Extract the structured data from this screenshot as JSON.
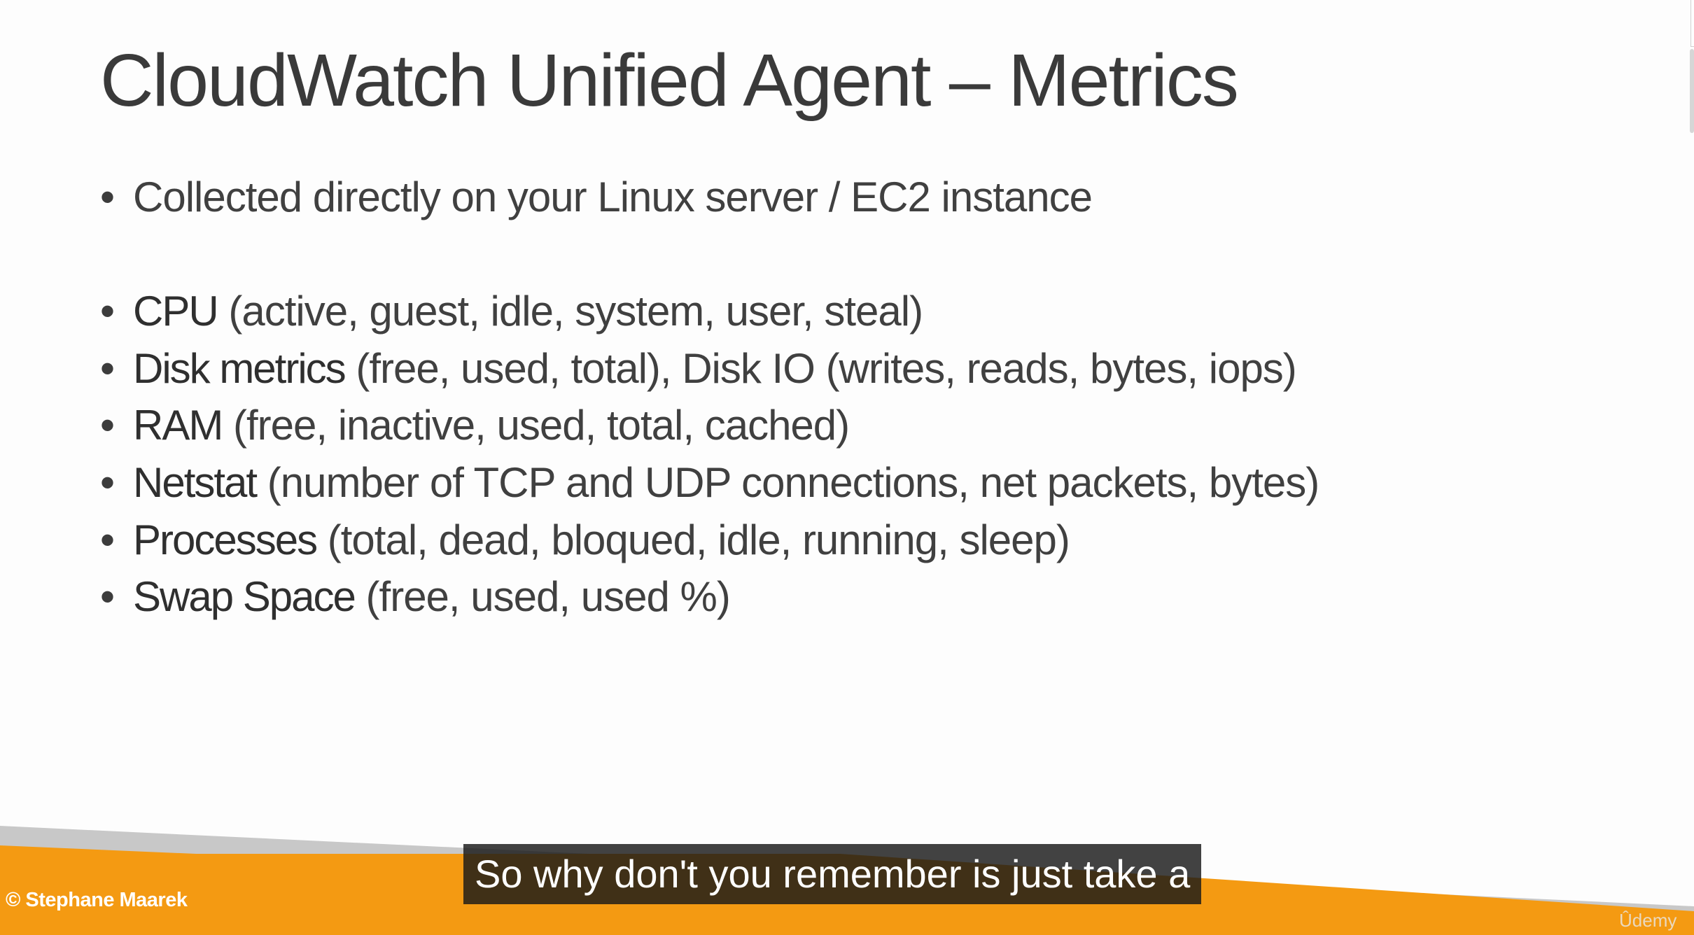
{
  "slide": {
    "title": "CloudWatch Unified Agent – Metrics",
    "bullets": [
      {
        "term": "",
        "desc": "Collected directly on your Linux server / EC2 instance"
      },
      {
        "term": "CPU",
        "desc": " (active, guest, idle, system, user, steal)"
      },
      {
        "term": "Disk metrics",
        "desc": " (free, used, total), Disk IO  (writes, reads, bytes, iops)"
      },
      {
        "term": "RAM",
        "desc": " (free, inactive, used, total, cached)"
      },
      {
        "term": "Netstat",
        "desc": " (number of TCP and UDP connections, net packets, bytes)"
      },
      {
        "term": "Processes",
        "desc": " (total, dead, bloqued, idle, running, sleep)"
      },
      {
        "term": "Swap Space",
        "desc": " (free, used, used %)"
      }
    ],
    "bullet_glyph": "•",
    "credit": "© Stephane Maarek"
  },
  "player": {
    "caption": "So why don't you remember is just take a",
    "watermark": "Ûdemy"
  },
  "colors": {
    "band_orange": "#f49a12",
    "band_gray": "#c8c8c8",
    "caption_bg": "#181818"
  }
}
